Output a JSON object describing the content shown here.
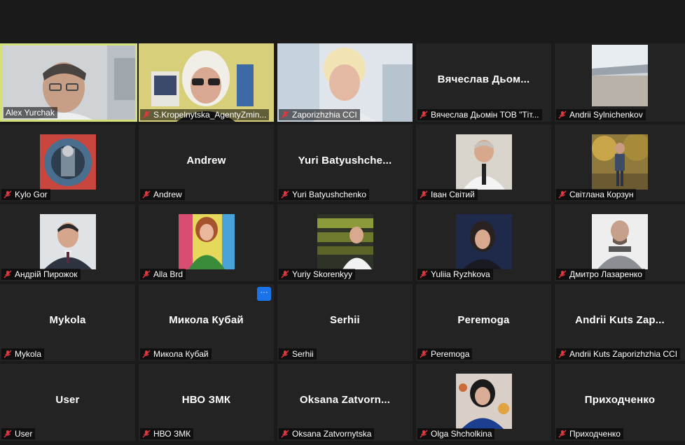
{
  "colors": {
    "background": "#1a1a1a",
    "tile": "#232323",
    "active_border": "#d4e07a",
    "muted_icon": "#e0383e",
    "more_button": "#1a73e8"
  },
  "more_button_label": "···",
  "participants": [
    {
      "label": "Alex Yurchak",
      "display": "",
      "type": "video",
      "active": true,
      "muted": false
    },
    {
      "label": "S.Kropelnytska_AgentyZmin...",
      "display": "",
      "type": "video",
      "muted": true
    },
    {
      "label": "Zaporizhzhia CCI",
      "display": "",
      "type": "video",
      "muted": true
    },
    {
      "label": "Вячеслав Дьомін ТОВ \"Тіт...",
      "display": "Вячеслав Дьом...",
      "type": "name",
      "muted": true
    },
    {
      "label": "Andrii Sylnichenkov",
      "display": "",
      "type": "photo",
      "muted": true
    },
    {
      "label": "Kylo Gor",
      "display": "",
      "type": "photo",
      "muted": true
    },
    {
      "label": "Andrew",
      "display": "Andrew",
      "type": "name",
      "muted": true
    },
    {
      "label": "Yuri Batyushchenko",
      "display": "Yuri Batyushche...",
      "type": "name",
      "muted": true
    },
    {
      "label": "Іван Світий",
      "display": "",
      "type": "photo",
      "muted": true
    },
    {
      "label": "Світлана Корзун",
      "display": "",
      "type": "photo",
      "muted": true
    },
    {
      "label": "Андрій Пирожок",
      "display": "",
      "type": "photo",
      "muted": true
    },
    {
      "label": "Alla Brd",
      "display": "",
      "type": "photo",
      "muted": true
    },
    {
      "label": "Yuriy Skorenkyy",
      "display": "",
      "type": "photo",
      "muted": true
    },
    {
      "label": "Yuliia Ryzhkova",
      "display": "",
      "type": "photo",
      "muted": true
    },
    {
      "label": "Дмитро Лазаренко",
      "display": "",
      "type": "photo",
      "muted": true
    },
    {
      "label": "Mykola",
      "display": "Mykola",
      "type": "name",
      "muted": true
    },
    {
      "label": "Микола Кубай",
      "display": "Микола Кубай",
      "type": "name",
      "muted": true,
      "more": true
    },
    {
      "label": "Serhii",
      "display": "Serhii",
      "type": "name",
      "muted": true
    },
    {
      "label": "Peremoga",
      "display": "Peremoga",
      "type": "name",
      "muted": true
    },
    {
      "label": "Andrii Kuts Zaporizhzhia CCI",
      "display": "Andrii Kuts Zap...",
      "type": "name",
      "muted": true
    },
    {
      "label": "User",
      "display": "User",
      "type": "name",
      "muted": true
    },
    {
      "label": "НВО ЗМК",
      "display": "НВО ЗМК",
      "type": "name",
      "muted": true
    },
    {
      "label": "Oksana Zatvornytska",
      "display": "Oksana Zatvorn...",
      "type": "name",
      "muted": true
    },
    {
      "label": "Olga Shcholkina",
      "display": "",
      "type": "photo",
      "muted": true
    },
    {
      "label": "Приходченко",
      "display": "Приходченко",
      "type": "name",
      "muted": true
    }
  ]
}
